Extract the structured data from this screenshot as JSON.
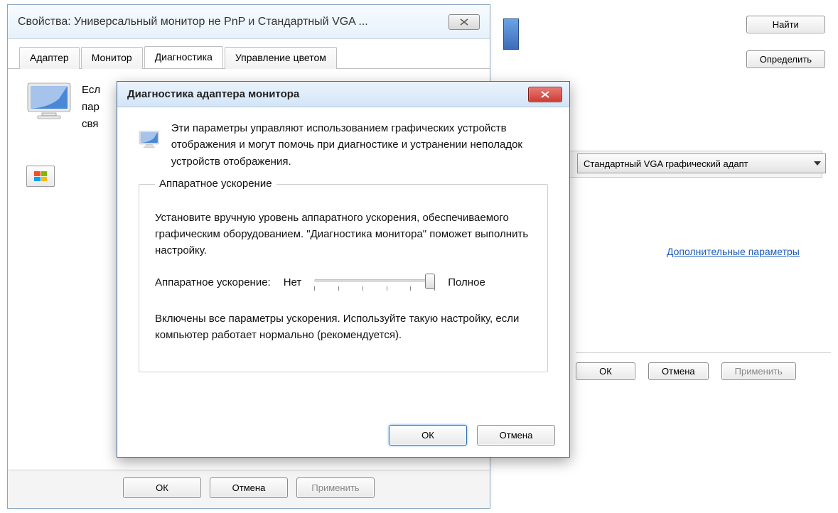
{
  "bg": {
    "find_btn": "Найти",
    "detect_btn": "Определить",
    "adapter_select": "Стандартный VGA графический адапт",
    "advanced_link": "Дополнительные параметры",
    "ok_btn": "ОК",
    "cancel_btn": "Отмена",
    "apply_btn": "Применить"
  },
  "prop": {
    "title": "Свойства: Универсальный монитор не PnP и Стандартный VGA ...",
    "tabs": {
      "adapter": "Адаптер",
      "monitor": "Монитор",
      "diagnostics": "Диагностика",
      "color": "Управление цветом"
    },
    "partial_lines": {
      "l1": "Есл",
      "l2": "пар",
      "l3": "свя"
    },
    "ok_btn": "ОК",
    "cancel_btn": "Отмена",
    "apply_btn": "Применить"
  },
  "diag": {
    "title": "Диагностика адаптера монитора",
    "intro": "Эти параметры управляют использованием графических устройств отображения и могут помочь при диагностике и устранении неполадок устройств отображения.",
    "group_title": "Аппаратное ускорение",
    "group_desc": "Установите вручную уровень аппаратного ускорения, обеспечиваемого графическим оборудованием. \"Диагностика монитора\" поможет выполнить настройку.",
    "slider_label": "Аппаратное ускорение:",
    "slider_min": "Нет",
    "slider_max": "Полное",
    "slider_ticks": 6,
    "slider_value": 5,
    "status_text": "Включены все параметры ускорения. Используйте такую настройку, если компьютер работает нормально (рекомендуется).",
    "ok_btn": "ОК",
    "cancel_btn": "Отмена"
  }
}
